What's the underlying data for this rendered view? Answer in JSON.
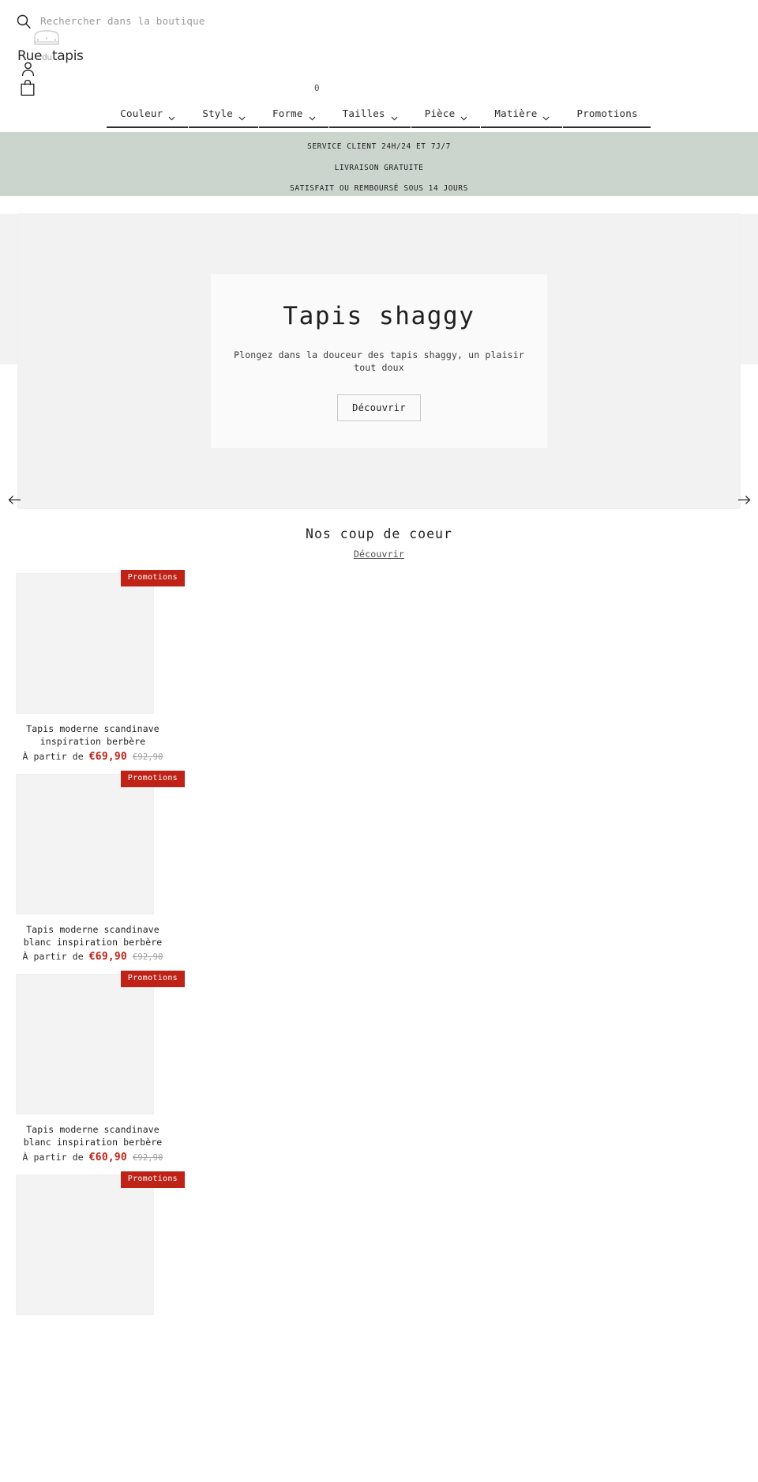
{
  "header": {
    "search": {
      "icon": "search-icon",
      "placeholder": "Rechercher dans la boutique",
      "value": ""
    },
    "logo": {
      "part1": "Rue",
      "part2": "du",
      "part3": "tapis",
      "icon": "rug-icon"
    },
    "account_icon": "user-icon",
    "cart_icon": "shopping-bag-icon",
    "cart_count": "0"
  },
  "nav": {
    "items": [
      {
        "label": "Couleur",
        "has_dropdown": true
      },
      {
        "label": "Style",
        "has_dropdown": true
      },
      {
        "label": "Forme",
        "has_dropdown": true
      },
      {
        "label": "Tailles",
        "has_dropdown": true
      },
      {
        "label": "Pièce",
        "has_dropdown": true
      },
      {
        "label": "Matière",
        "has_dropdown": true
      },
      {
        "label": "Promotions",
        "has_dropdown": false
      }
    ]
  },
  "announcement": {
    "background": "#ccd5cd",
    "lines": [
      "SERVICE CLIENT 24H/24 ET 7J/7",
      "LIVRAISON GRATUITE",
      "SATISFAIT OU REMBOURSÉ SOUS 14 JOURS"
    ]
  },
  "hero": {
    "title": "Tapis shaggy",
    "subtitle": "Plongez dans la douceur des tapis shaggy, un plaisir tout doux",
    "button": "Découvrir",
    "prev_icon": "arrow-left-icon",
    "next_icon": "arrow-right-icon"
  },
  "featured": {
    "title": "Nos coup de coeur",
    "link": "Découvrir"
  },
  "products": [
    {
      "badge": "Promotions",
      "title": "Tapis moderne scandinave inspiration berbère",
      "price_prefix": "À partir de",
      "price": "€69,90",
      "compare_price": "€92,90"
    },
    {
      "badge": "Promotions",
      "title": "Tapis moderne scandinave blanc inspiration berbère",
      "price_prefix": "À partir de",
      "price": "€69,90",
      "compare_price": "€92,90"
    },
    {
      "badge": "Promotions",
      "title": "Tapis moderne scandinave blanc inspiration berbère",
      "price_prefix": "À partir de",
      "price": "€60,90",
      "compare_price": "€92,90"
    },
    {
      "badge": "Promotions",
      "title": "",
      "price_prefix": "",
      "price": "",
      "compare_price": ""
    }
  ],
  "colors": {
    "accent_red": "#bf2318",
    "announce_bg": "#ccd5cd",
    "placeholder_gray": "#f3f3f3"
  }
}
